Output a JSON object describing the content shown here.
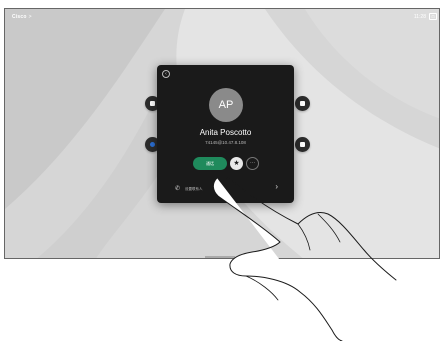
{
  "status_bar": {
    "device_label": "Cisco",
    "chevron": ">",
    "time": "11:28",
    "box_glyph": "⊡"
  },
  "background_icons": [
    {
      "name": "icon-left-top",
      "color": "#2c2c2c"
    },
    {
      "name": "icon-left-bottom",
      "color": "#2b6fd4"
    },
    {
      "name": "icon-right-top",
      "color": "#2c2c2c"
    },
    {
      "name": "icon-right-bottom",
      "color": "#2c2c2c"
    }
  ],
  "contact_card": {
    "back_icon": "chevron-left-icon",
    "back_glyph": "‹",
    "avatar_initials": "AP",
    "name": "Anita Poscotto",
    "address": "74145@10.47.8.108",
    "call_label": "通话",
    "favorite_glyph": "★",
    "more_glyph": "···",
    "phone_glyph": "✆",
    "phone_label": "设置联系人",
    "chevron_glyph": "›"
  },
  "colors": {
    "card": "#1a1a1a",
    "call_green": "#1f8a5c",
    "avatar_gray": "#8a8a8a",
    "screen_gray": "#d9d9d9"
  }
}
